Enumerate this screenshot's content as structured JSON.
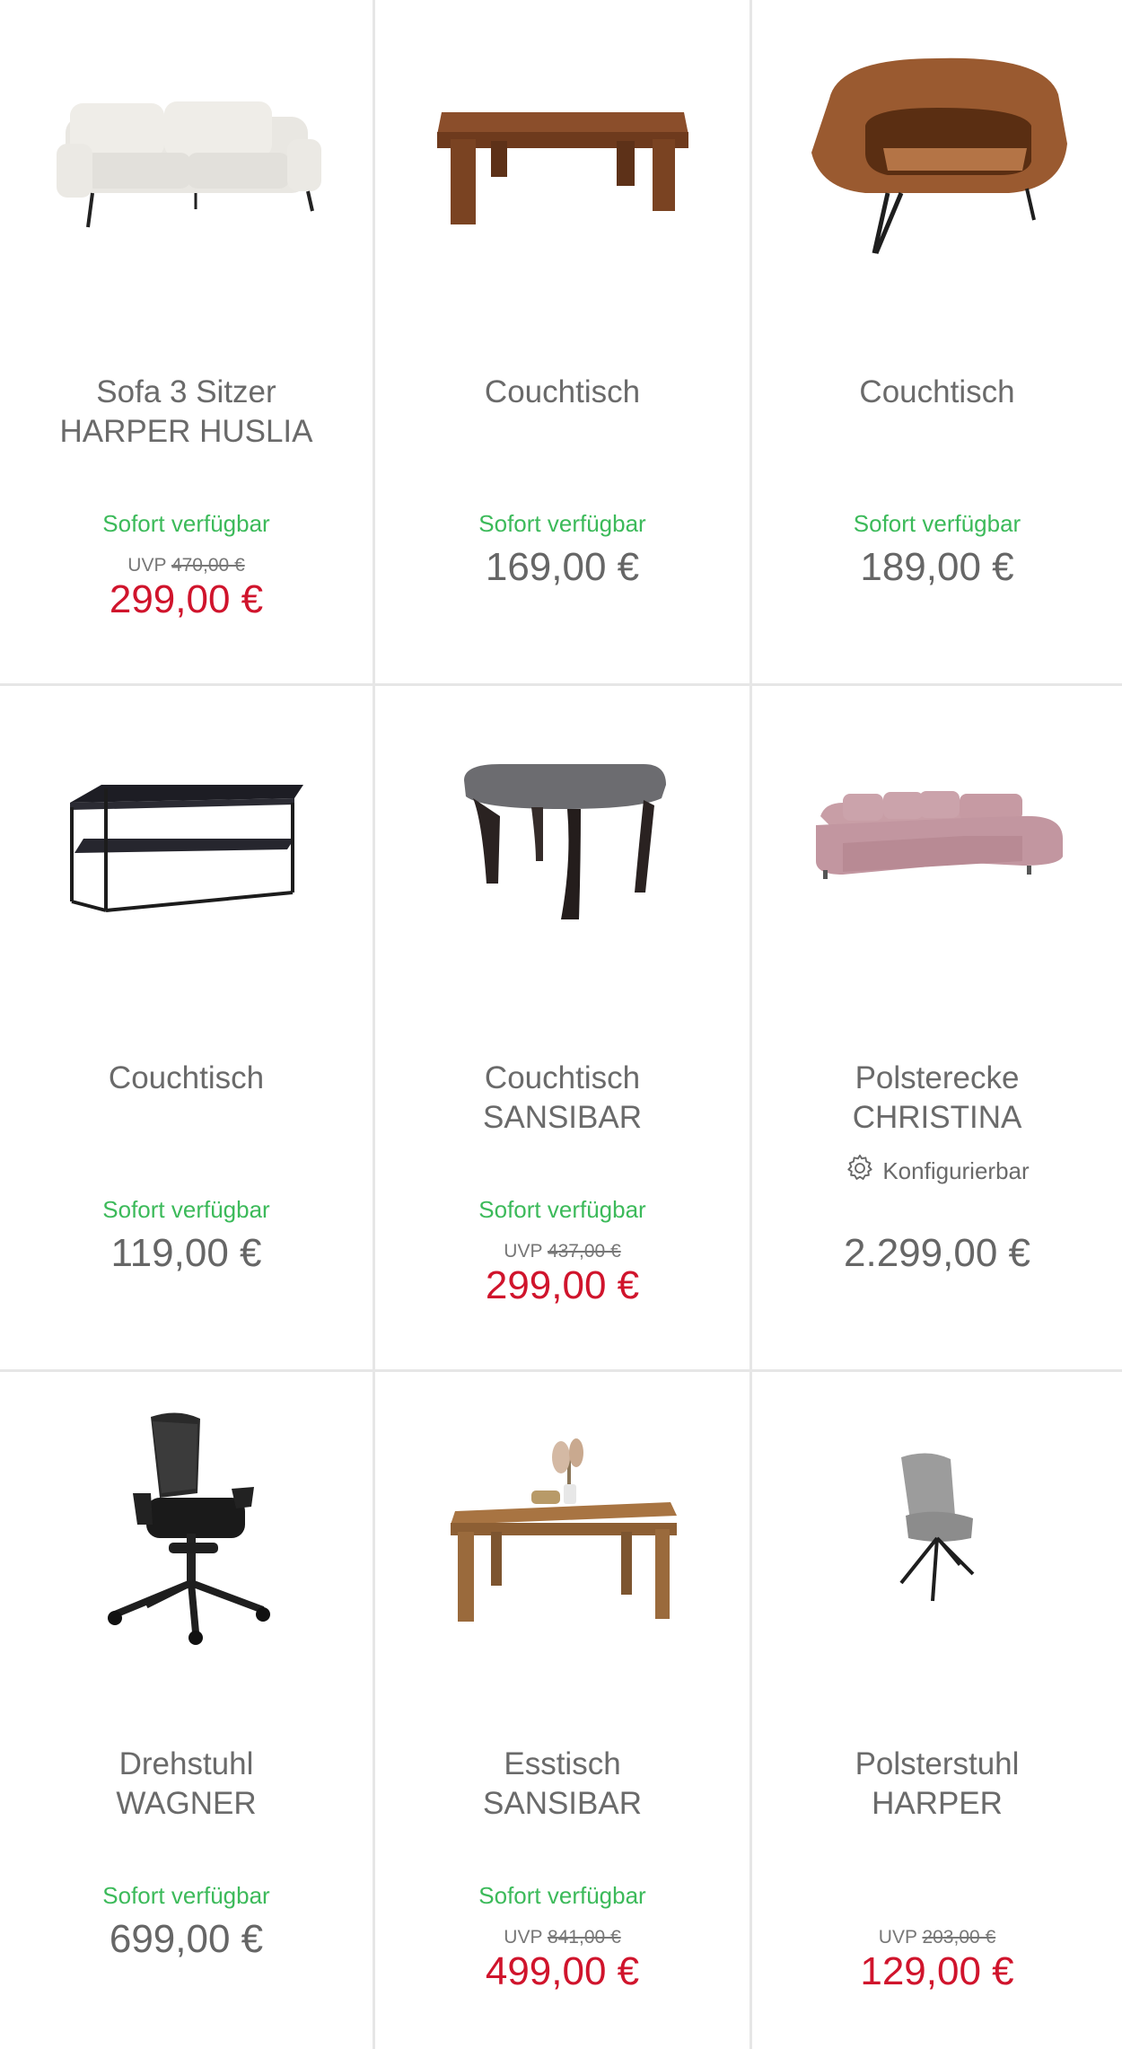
{
  "products": [
    {
      "title1": "Sofa 3 Sitzer",
      "title2": "HARPER HUSLIA",
      "availability": "Sofort verfügbar",
      "uvp_label": "UVP",
      "uvp_price": "470,00 €",
      "price": "299,00 €"
    },
    {
      "title1": "Couchtisch",
      "title2": "",
      "availability": "Sofort verfügbar",
      "price": "169,00 €"
    },
    {
      "title1": "Couchtisch",
      "title2": "",
      "availability": "Sofort verfügbar",
      "price": "189,00 €"
    },
    {
      "title1": "Couchtisch",
      "title2": "",
      "availability": "Sofort verfügbar",
      "price": "119,00 €"
    },
    {
      "title1": "Couchtisch",
      "title2": "SANSIBAR",
      "availability": "Sofort verfügbar",
      "uvp_label": "UVP",
      "uvp_price": "437,00 €",
      "price": "299,00 €"
    },
    {
      "title1": "Polsterecke",
      "title2": "CHRISTINA",
      "config_label": "Konfigurierbar",
      "price": "2.299,00 €"
    },
    {
      "title1": "Drehstuhl",
      "title2": "WAGNER",
      "availability": "Sofort verfügbar",
      "price": "699,00 €"
    },
    {
      "title1": "Esstisch",
      "title2": "SANSIBAR",
      "availability": "Sofort verfügbar",
      "uvp_label": "UVP",
      "uvp_price": "841,00 €",
      "price": "499,00 €"
    },
    {
      "title1": "Polsterstuhl",
      "title2": "HARPER",
      "uvp_label": "UVP",
      "uvp_price": "203,00 €",
      "price": "129,00 €"
    }
  ],
  "colors": {
    "availability": "#3cba5a",
    "sale_price": "#d0142c",
    "text": "#666666",
    "divider": "#e6e6e6"
  },
  "icons": [
    "sofa-image",
    "coffee-table-image",
    "curved-coffee-table-image",
    "metal-coffee-table-image",
    "square-coffee-table-image",
    "corner-sofa-image",
    "office-chair-image",
    "dining-table-image",
    "upholstered-chair-image",
    "gear-icon"
  ]
}
